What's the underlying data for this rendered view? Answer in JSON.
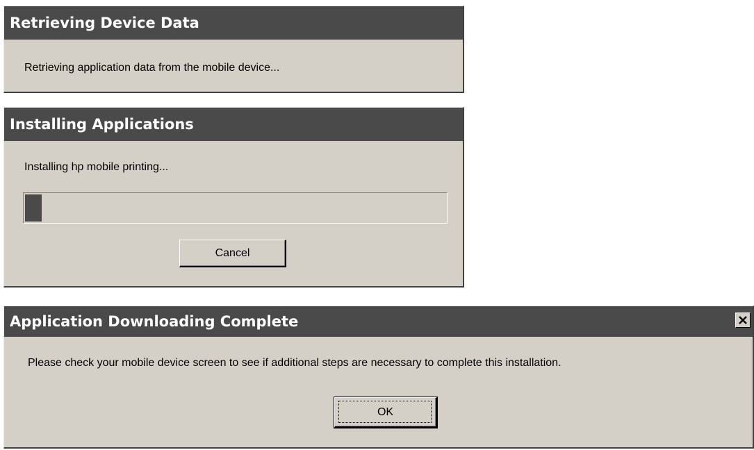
{
  "dialog_retrieving": {
    "title": "Retrieving Device Data",
    "message": "Retrieving application data from the mobile device..."
  },
  "dialog_installing": {
    "title": "Installing Applications",
    "message": "Installing hp mobile printing...",
    "progress_fraction": 0.04,
    "cancel_label": "Cancel"
  },
  "dialog_complete": {
    "title": "Application Downloading Complete",
    "message": "Please check your mobile device screen to see if additional steps are necessary to complete this installation.",
    "ok_label": "OK",
    "close_icon": "close-icon"
  },
  "colors": {
    "titlebar": "#4a4a4a",
    "dialog_face": "#d4d0c8",
    "progress_fill": "#4a4a4a"
  }
}
